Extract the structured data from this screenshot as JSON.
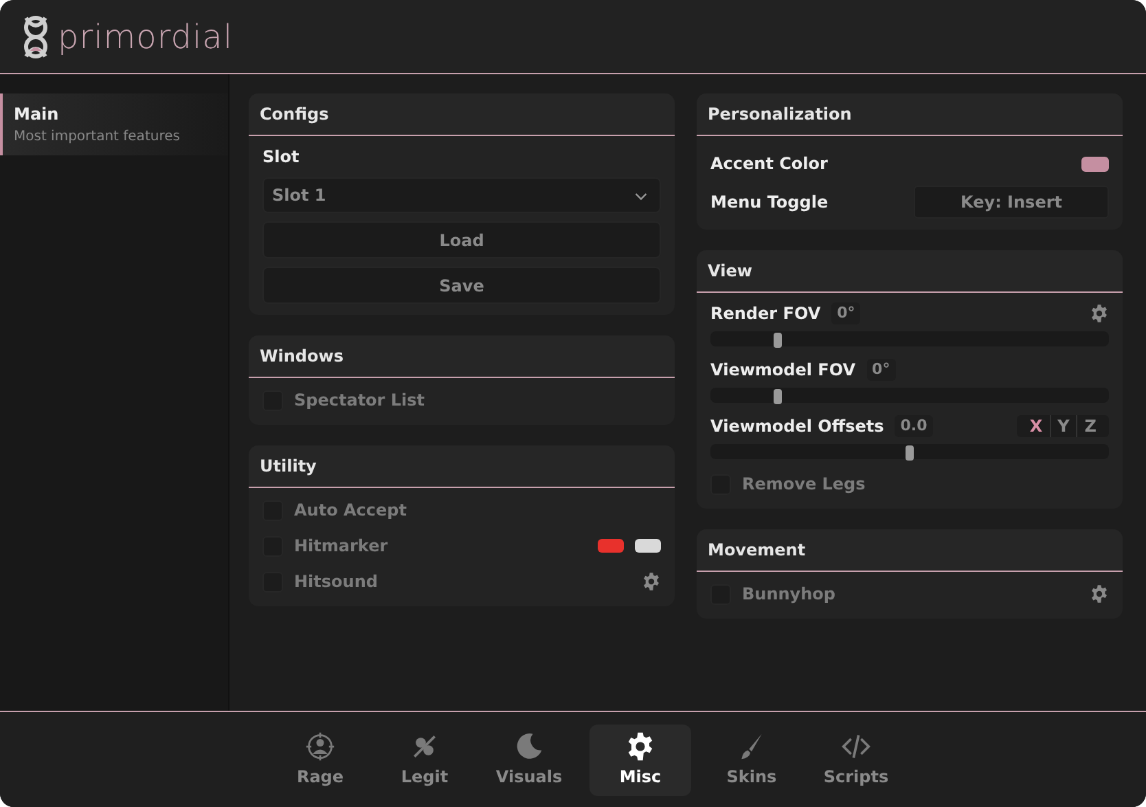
{
  "app": {
    "title": "primordial"
  },
  "sidebar": {
    "items": [
      {
        "label": "Main",
        "description": "Most important features",
        "selected": true
      }
    ]
  },
  "columns": [
    [
      {
        "title": "Configs",
        "rows": [
          {
            "kind": "select",
            "label": "Slot",
            "value": "Slot 1"
          },
          {
            "kind": "button",
            "label": "Load"
          },
          {
            "kind": "button",
            "label": "Save"
          }
        ]
      },
      {
        "title": "Windows",
        "rows": [
          {
            "kind": "checkbox",
            "label": "Spectator List",
            "checked": false
          }
        ]
      },
      {
        "title": "Utility",
        "rows": [
          {
            "kind": "checkbox",
            "label": "Auto Accept",
            "checked": false
          },
          {
            "kind": "checkbox",
            "label": "Hitmarker",
            "checked": false,
            "swatches": [
              {
                "color": "#e8312c"
              },
              {
                "color": "#d9d9d9"
              }
            ]
          },
          {
            "kind": "checkbox",
            "label": "Hitsound",
            "checked": false,
            "settings": true
          }
        ]
      }
    ],
    [
      {
        "title": "Personalization",
        "rows": [
          {
            "kind": "color",
            "label": "Accent Color",
            "color": "#c58fa1"
          },
          {
            "kind": "keybind",
            "label": "Menu Toggle",
            "value": "Key: Insert"
          }
        ]
      },
      {
        "title": "View",
        "rows": [
          {
            "kind": "slider",
            "label": "Render FOV",
            "reading": "0°",
            "level": 0.17,
            "settings": true
          },
          {
            "kind": "slider",
            "label": "Viewmodel FOV",
            "reading": "0°",
            "level": 0.17
          },
          {
            "kind": "slider",
            "label": "Viewmodel Offsets",
            "reading": "0.0",
            "level": 0.5,
            "axes": [
              {
                "label": "X",
                "selected": true
              },
              {
                "label": "Y",
                "selected": false
              },
              {
                "label": "Z",
                "selected": false
              }
            ]
          },
          {
            "kind": "checkbox",
            "label": "Remove Legs",
            "checked": false
          }
        ]
      },
      {
        "title": "Movement",
        "rows": [
          {
            "kind": "checkbox",
            "label": "Bunnyhop",
            "checked": false,
            "settings": true
          }
        ]
      }
    ]
  ],
  "tabs": [
    {
      "label": "Rage",
      "selected": false
    },
    {
      "label": "Legit",
      "selected": false
    },
    {
      "label": "Visuals",
      "selected": false
    },
    {
      "label": "Misc",
      "selected": true
    },
    {
      "label": "Skins",
      "selected": false
    },
    {
      "label": "Scripts",
      "selected": false
    }
  ]
}
